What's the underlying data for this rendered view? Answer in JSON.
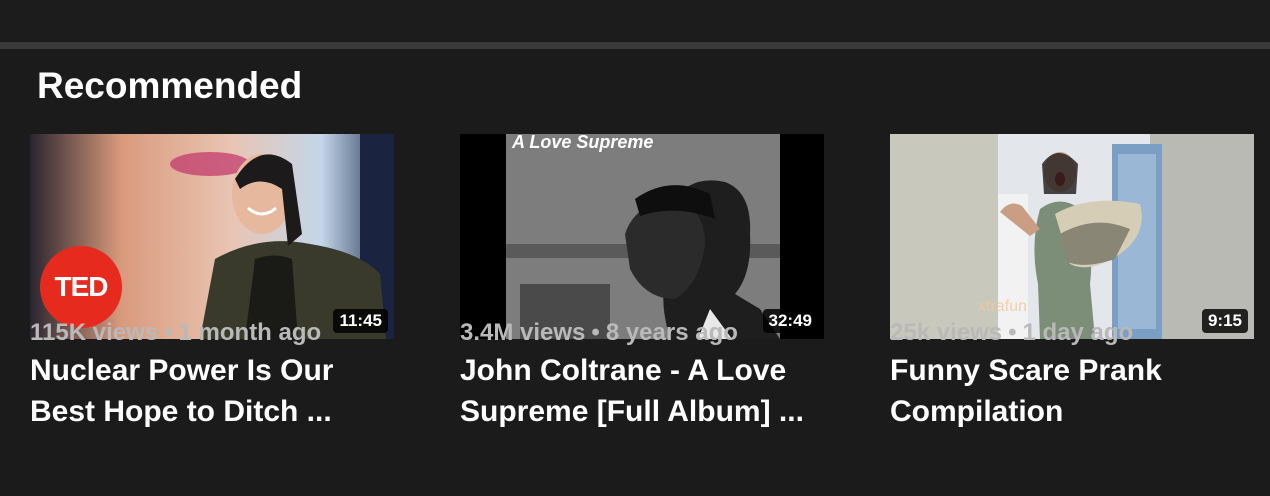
{
  "section": {
    "title": "Recommended"
  },
  "videos": [
    {
      "title": "Nuclear Power Is Our\nBest Hope to Ditch ...",
      "duration": "11:45",
      "views": "115K views",
      "age": "1 month ago",
      "channel_badge": "TED",
      "thumbnail_icon": "ted-talk-thumbnail"
    },
    {
      "title": "John Coltrane - A Love\nSupreme [Full Album] ...",
      "duration": "32:49",
      "views": "3.4M views",
      "age": "8 years ago",
      "cover_text": "A Love Supreme",
      "thumbnail_icon": "album-cover-thumbnail"
    },
    {
      "title": "Funny Scare Prank\nCompilation",
      "duration": "9:15",
      "views": "25k views",
      "age": "1 day ago",
      "watermark": "xtrafun",
      "thumbnail_icon": "prank-video-thumbnail"
    }
  ],
  "meta_separator": "•",
  "colors": {
    "background": "#1b1b1b",
    "title_text": "#ffffff",
    "meta_text": "#b9b9b9",
    "ted_red": "#e62b1e"
  }
}
